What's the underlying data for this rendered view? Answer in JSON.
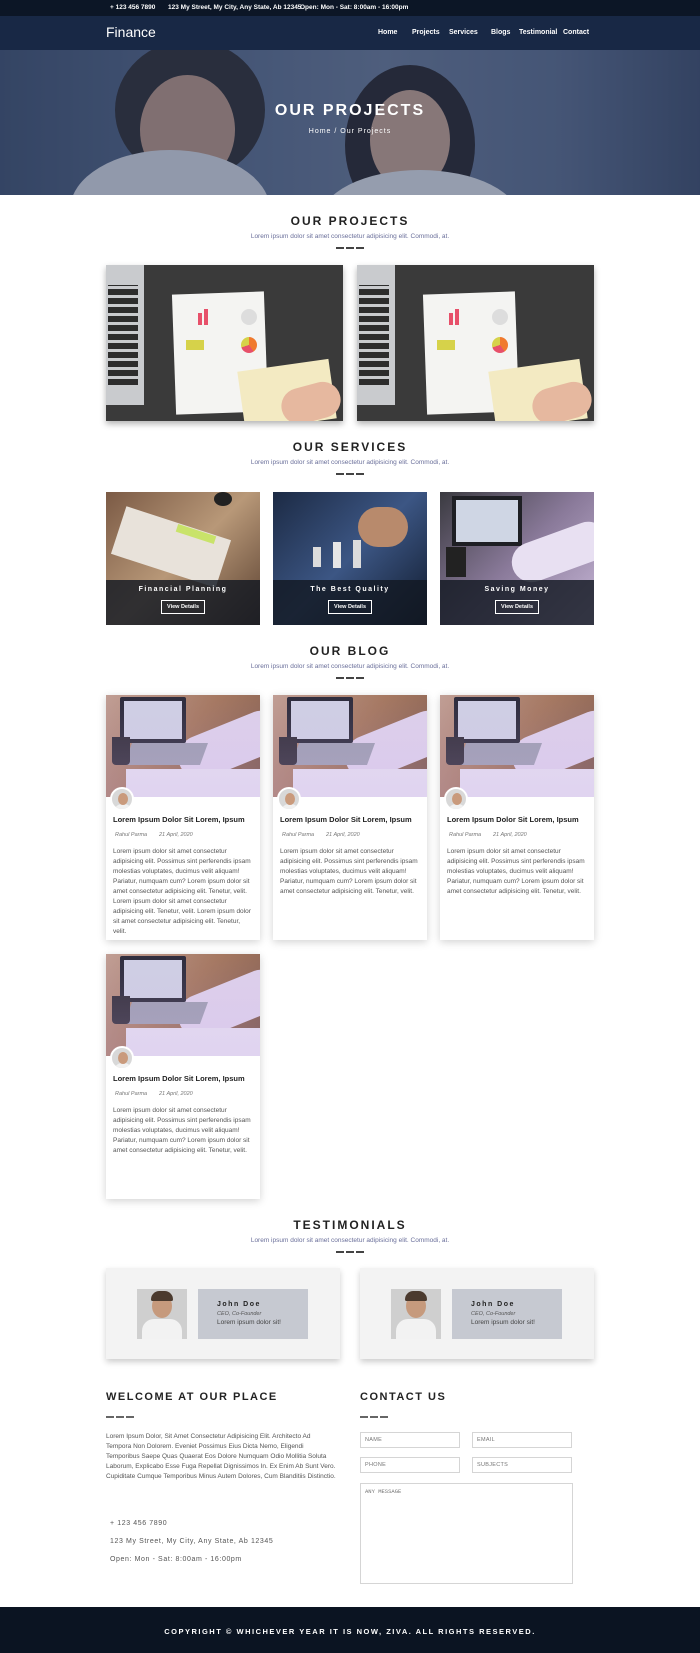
{
  "topbar": {
    "phone": "+ 123 456 7890",
    "address": "123 My Street, My City, Any State, Ab 12345",
    "hours": "Open: Mon - Sat: 8:00am - 16:00pm"
  },
  "nav": {
    "brand": "Finance",
    "items": [
      "Home",
      "Projects",
      "Services",
      "Blogs",
      "Testimonial",
      "Contact"
    ]
  },
  "hero": {
    "title": "OUR PROJECTS",
    "breadcrumb": "Home / Our Projects"
  },
  "projects": {
    "title": "OUR PROJECTS",
    "subtitle": "Lorem ipsum dolor sit amet consectetur adipisicing elit. Commodi, at."
  },
  "services": {
    "title": "OUR SERVICES",
    "subtitle": "Lorem ipsum dolor sit amet consectetur adipisicing elit. Commodi, at.",
    "cards": [
      {
        "title": "Financial Planning",
        "button": "View Details"
      },
      {
        "title": "The Best Quality",
        "button": "View Details"
      },
      {
        "title": "Saving Money",
        "button": "View Details"
      }
    ]
  },
  "blog": {
    "title": "OUR BLOG",
    "subtitle": "Lorem ipsum dolor sit amet consectetur adipisicing elit. Commodi, at.",
    "posts": [
      {
        "title": "Lorem Ipsum Dolor Sit Lorem, Ipsum",
        "author": "Rahul Parma",
        "date": "21 April, 2020",
        "text": "Lorem ipsum dolor sit amet consectetur adipisicing elit. Possimus sint perferendis ipsam molestias voluptates, ducimus velit aliquam! Pariatur, numquam cum? Lorem ipsum dolor sit amet consectetur adipisicing elit. Tenetur, velit. Lorem ipsum dolor sit amet consectetur adipisicing elit. Tenetur, velit. Lorem ipsum dolor sit amet consectetur adipisicing elit. Tenetur, velit."
      },
      {
        "title": "Lorem Ipsum Dolor Sit Lorem, Ipsum",
        "author": "Rahul Parma",
        "date": "21 April, 2020",
        "text": "Lorem ipsum dolor sit amet consectetur adipisicing elit. Possimus sint perferendis ipsam molestias voluptates, ducimus velit aliquam! Pariatur, numquam cum? Lorem ipsum dolor sit amet consectetur adipisicing elit. Tenetur, velit."
      },
      {
        "title": "Lorem Ipsum Dolor Sit Lorem, Ipsum",
        "author": "Rahul Parma",
        "date": "21 April, 2020",
        "text": "Lorem ipsum dolor sit amet consectetur adipisicing elit. Possimus sint perferendis ipsam molestias voluptates, ducimus velit aliquam! Pariatur, numquam cum? Lorem ipsum dolor sit amet consectetur adipisicing elit. Tenetur, velit."
      },
      {
        "title": "Lorem Ipsum Dolor Sit Lorem, Ipsum",
        "author": "Rahul Parma",
        "date": "21 April, 2020",
        "text": "Lorem ipsum dolor sit amet consectetur adipisicing elit. Possimus sint perferendis ipsam molestias voluptates, ducimus velit aliquam! Pariatur, numquam cum? Lorem ipsum dolor sit amet consectetur adipisicing elit. Tenetur, velit."
      }
    ]
  },
  "testimonials": {
    "title": "TESTIMONIALS",
    "subtitle": "Lorem ipsum dolor sit amet consectetur adipisicing elit. Commodi, at.",
    "items": [
      {
        "name": "John Doe",
        "role": "CEO, Co-Founder",
        "quote": "Lorem ipsum dolor sit!"
      },
      {
        "name": "John Doe",
        "role": "CEO, Co-Founder",
        "quote": "Lorem ipsum dolor sit!"
      }
    ]
  },
  "welcome": {
    "title": "WELCOME AT OUR PLACE",
    "text": "Lorem Ipsum Dolor, Sit Amet Consectetur Adipisicing Elit. Architecto Ad Tempora Non Dolorem. Eveniet Possimus Eius Dicta Nemo, Eligendi Temporibus Saepe Quas Quaerat Eos Dolore Numquam Odio Mollitia Soluta Laborum, Explicabo Esse Fuga Repellat Dignissimos In. Ex Enim Ab Sunt Vero. Cupiditate Cumque Temporibus Minus Autem Dolores, Cum Blanditiis Distinctio.",
    "phone": "+ 123 456 7890",
    "address": "123 My Street, My City, Any State, Ab 12345",
    "hours": "Open: Mon - Sat: 8:00am - 16:00pm"
  },
  "contact": {
    "title": "CONTACT US",
    "name_placeholder": "NAME",
    "email_placeholder": "EMAIL",
    "phone_placeholder": "PHONE",
    "subjects_placeholder": "SUBJECTS",
    "message_placeholder": "ANY MESSAGE"
  },
  "footer": {
    "text": "COPYRIGHT © WHICHEVER YEAR IT IS NOW, ZIVA. ALL RIGHTS RESERVED."
  },
  "colors": {
    "topbar": "#0c1626",
    "navbar": "#182845",
    "footer": "#0b1422",
    "subtitle": "#6a6f9a"
  }
}
